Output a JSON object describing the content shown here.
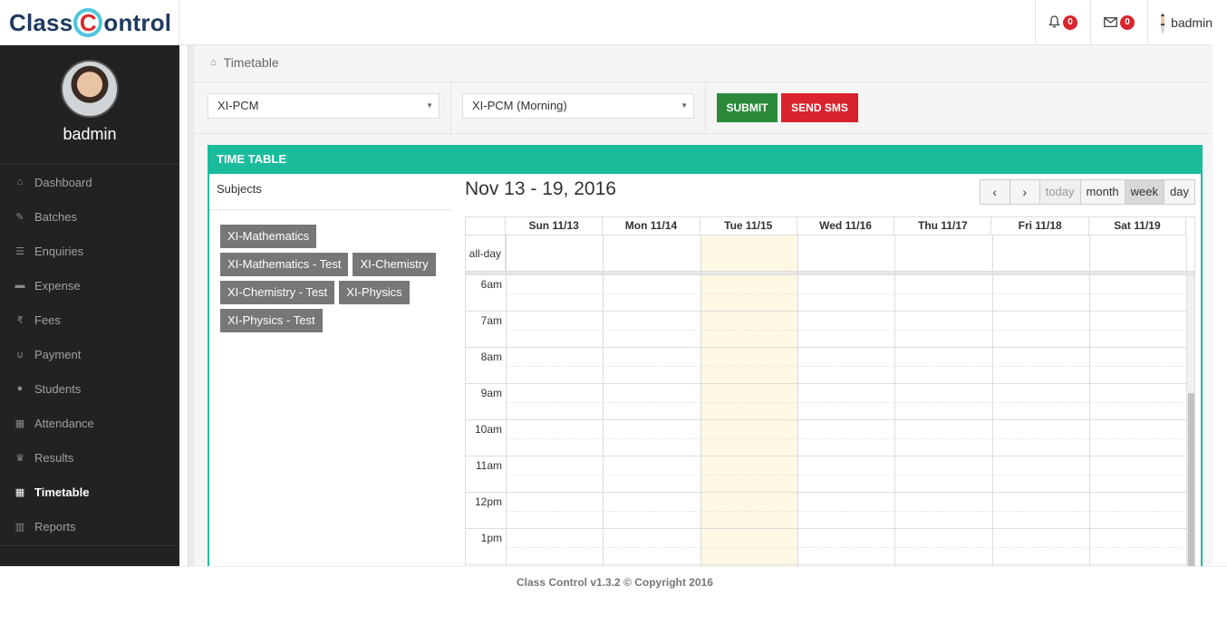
{
  "app": {
    "logo_left": "Class",
    "logo_c": "C",
    "logo_right": "ontrol",
    "accent": "#1abc9c",
    "sidebar_bg": "#222222"
  },
  "topbar": {
    "notifications_count": "0",
    "messages_count": "0",
    "username": "badmin",
    "bell_icon": "bell-icon",
    "mail_icon": "envelope-icon"
  },
  "sidebar": {
    "profile_name": "badmin",
    "items": [
      {
        "label": "Dashboard",
        "icon": "home-icon"
      },
      {
        "label": "Batches",
        "icon": "pencil-icon"
      },
      {
        "label": "Enquiries",
        "icon": "list-icon"
      },
      {
        "label": "Expense",
        "icon": "cart-icon"
      },
      {
        "label": "Fees",
        "icon": "rupee-icon"
      },
      {
        "label": "Payment",
        "icon": "magnet-icon"
      },
      {
        "label": "Students",
        "icon": "users-icon"
      },
      {
        "label": "Attendance",
        "icon": "calendar-icon"
      },
      {
        "label": "Results",
        "icon": "trophy-icon"
      },
      {
        "label": "Timetable",
        "icon": "calendar-icon",
        "active": true
      },
      {
        "label": "Reports",
        "icon": "bank-icon"
      }
    ]
  },
  "breadcrumb": {
    "label": "Timetable"
  },
  "filters": {
    "batch_select": "XI-PCM",
    "timetable_select": "XI-PCM (Morning)",
    "submit_label": "SUBMIT",
    "sms_label": "SEND SMS"
  },
  "panel": {
    "title": "TIME TABLE",
    "subjects_title": "Subjects",
    "subjects": [
      "XI-Mathematics",
      "XI-Mathematics - Test",
      "XI-Chemistry",
      "XI-Chemistry - Test",
      "XI-Physics",
      "XI-Physics - Test"
    ]
  },
  "calendar": {
    "range_title": "Nov 13 - 19, 2016",
    "prev_label": "‹",
    "next_label": "›",
    "today_label": "today",
    "month_label": "month",
    "week_label": "week",
    "day_label": "day",
    "days": [
      "Sun 11/13",
      "Mon 11/14",
      "Tue 11/15",
      "Wed 11/16",
      "Thu 11/17",
      "Fri 11/18",
      "Sat 11/19"
    ],
    "today_index": 2,
    "allday_label": "all-day",
    "hours": [
      "6am",
      "7am",
      "8am",
      "9am",
      "10am",
      "11am",
      "12pm",
      "1pm"
    ]
  },
  "footer": {
    "text": "Class Control v1.3.2 © Copyright 2016"
  }
}
